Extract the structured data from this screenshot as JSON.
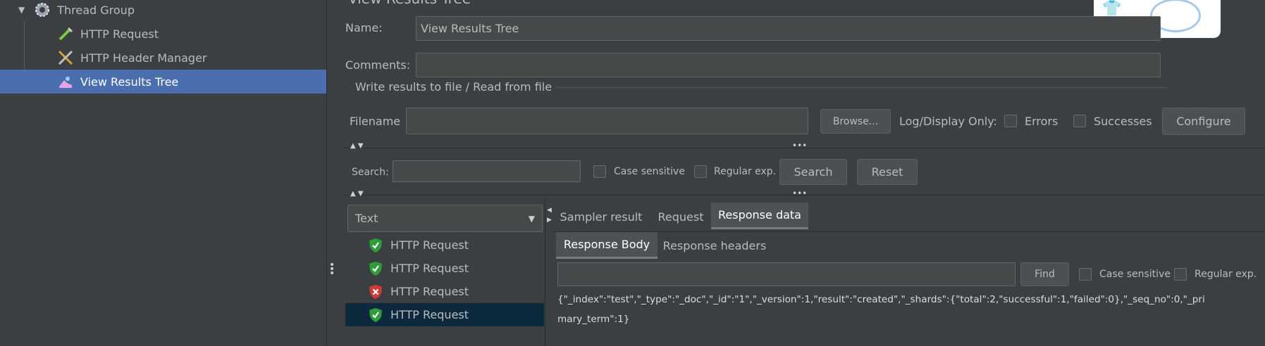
{
  "tree": {
    "items": [
      {
        "label": "Thread Group",
        "icon": "gear-icon"
      },
      {
        "label": "HTTP Request",
        "icon": "pipette-icon"
      },
      {
        "label": "HTTP Header Manager",
        "icon": "tools-icon"
      },
      {
        "label": "View Results Tree",
        "icon": "results-tree-icon"
      }
    ]
  },
  "form": {
    "title_partial": "View Results Tree",
    "name_label": "Name:",
    "name_value": "View Results Tree",
    "comments_label": "Comments:",
    "comments_value": "",
    "group_title": "Write results to file / Read from file",
    "filename_label": "Filename",
    "filename_value": "",
    "browse_label": "Browse...",
    "log_display_label": "Log/Display Only:",
    "errors_label": "Errors",
    "successes_label": "Successes",
    "configure_label": "Configure"
  },
  "search": {
    "label": "Search:",
    "value": "",
    "case_sensitive_label": "Case sensitive",
    "regex_label": "Regular exp.",
    "search_button": "Search",
    "reset_button": "Reset"
  },
  "results": {
    "renderer_selected": "Text",
    "rows": [
      {
        "label": "HTTP Request",
        "status": "success"
      },
      {
        "label": "HTTP Request",
        "status": "success"
      },
      {
        "label": "HTTP Request",
        "status": "error"
      },
      {
        "label": "HTTP Request",
        "status": "success"
      }
    ]
  },
  "detail": {
    "tabs": [
      "Sampler result",
      "Request",
      "Response data"
    ],
    "active_tab": "Response data",
    "subtabs": [
      "Response Body",
      "Response headers"
    ],
    "active_subtab": "Response Body",
    "find_value": "",
    "find_button": "Find",
    "case_sensitive_label": "Case sensitive",
    "regex_label": "Regular exp.",
    "response_line1": "{\"_index\":\"test\",\"_type\":\"_doc\",\"_id\":\"1\",\"_version\":1,\"result\":\"created\",\"_shards\":{\"total\":2,\"successful\":1,\"failed\":0},\"_seq_no\":0,\"_pri",
    "response_line2": "mary_term\":1}"
  },
  "colors": {
    "background": "#3c3f41",
    "selection": "#4b6eaf",
    "result_selection": "#0d293e",
    "success": "#2e9e3a",
    "error": "#d03a3a"
  }
}
